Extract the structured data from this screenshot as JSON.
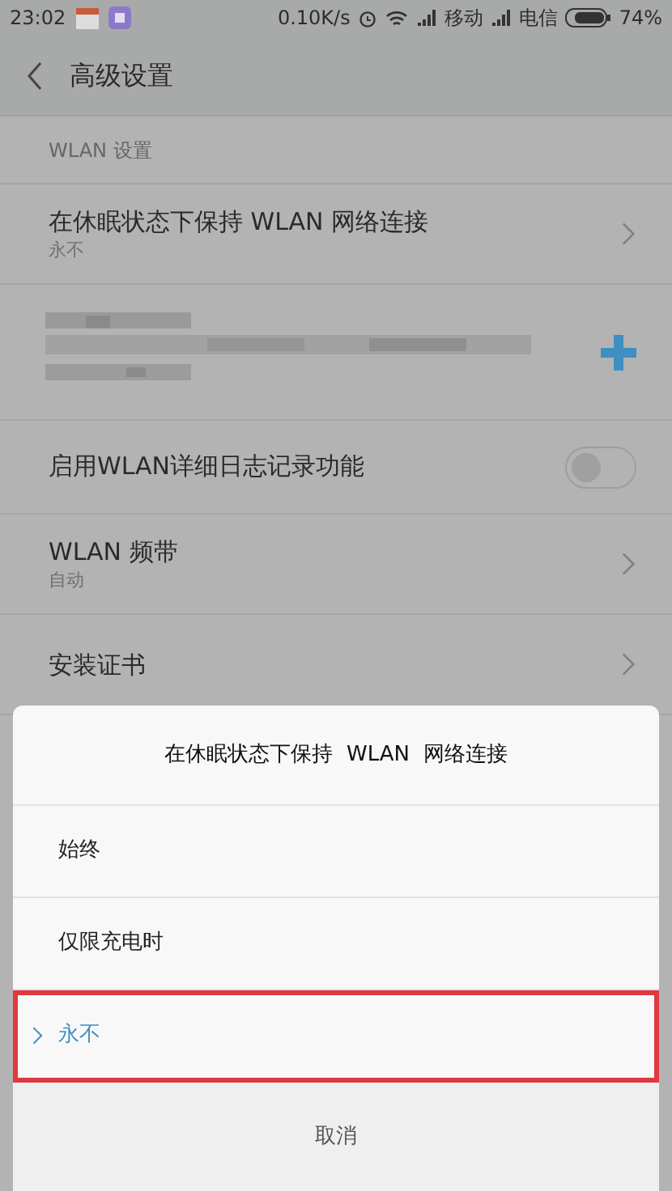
{
  "status_bar": {
    "time": "23:02",
    "network_speed": "0.10K/s",
    "carrier_1": "移动",
    "carrier_2": "电信",
    "battery_percent": "74%"
  },
  "header": {
    "title": "高级设置"
  },
  "section_label": "WLAN 设置",
  "settings": [
    {
      "kind": "link",
      "title": "在休眠状态下保持 WLAN 网络连接",
      "subtitle": "永不"
    },
    {
      "kind": "blurred"
    },
    {
      "kind": "toggle",
      "title": "启用WLAN详细日志记录功能",
      "on": false
    },
    {
      "kind": "link",
      "title": "WLAN 频带",
      "subtitle": "自动"
    },
    {
      "kind": "link",
      "title": "安装证书"
    }
  ],
  "dialog": {
    "title": "在休眠状态下保持  WLAN  网络连接",
    "options": [
      {
        "label": "始终",
        "selected": false,
        "highlighted": false
      },
      {
        "label": "仅限充电时",
        "selected": false,
        "highlighted": false
      },
      {
        "label": "永不",
        "selected": true,
        "highlighted": true
      }
    ],
    "cancel": "取消"
  }
}
